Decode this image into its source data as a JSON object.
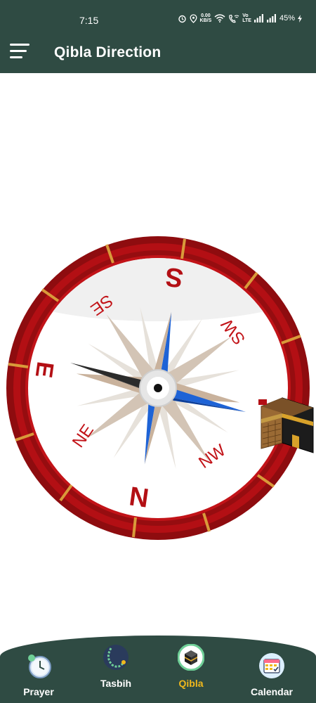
{
  "status_bar": {
    "time": "7:15",
    "net_speed_value": "0.00",
    "net_speed_unit": "KB/S",
    "volte_top": "Vo",
    "volte_bottom": "LTE",
    "battery": "45%"
  },
  "app_bar": {
    "title": "Qibla Direction",
    "menu_icon": "hamburger-menu-icon"
  },
  "compass": {
    "directions": {
      "north": "N",
      "south": "S",
      "east": "E",
      "west": "",
      "northeast": "NE",
      "northwest": "NW",
      "southeast": "SE",
      "southwest": "SW"
    },
    "qibla_marker_icon": "kaaba-icon"
  },
  "bottom_nav": {
    "items": [
      {
        "label": "Prayer",
        "icon": "clock-icon"
      },
      {
        "label": "Tasbih",
        "icon": "prayer-beads-icon"
      },
      {
        "label": "Qibla",
        "icon": "kaaba-icon"
      },
      {
        "label": "Calendar",
        "icon": "calendar-icon"
      }
    ],
    "active_index": 2
  },
  "colors": {
    "bar_green": "#2f4b43",
    "compass_red": "#b30f14",
    "compass_dark_red": "#7a0a0c",
    "tick_orange": "#d99a3a",
    "needle_blue": "#1e63d6",
    "needle_dark": "#2b2b2b",
    "active_label": "#f0b81c"
  }
}
